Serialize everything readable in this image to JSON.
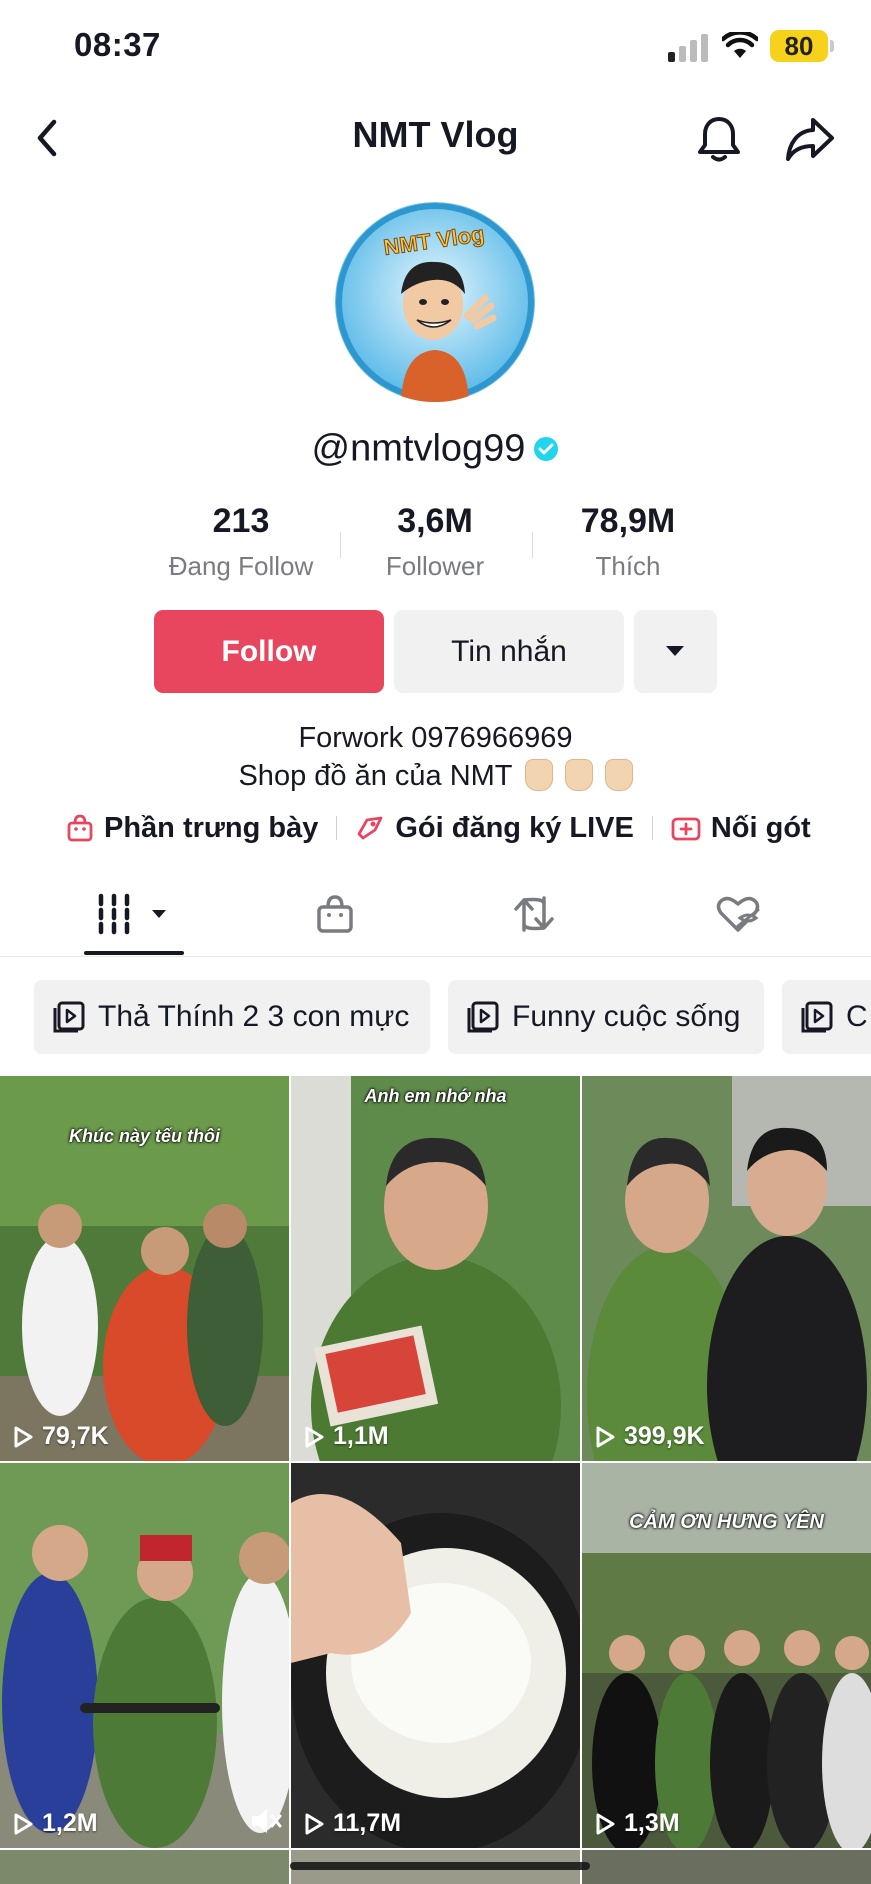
{
  "status_bar": {
    "time": "08:37",
    "battery": "80"
  },
  "header": {
    "title": "NMT Vlog"
  },
  "profile": {
    "avatar_text": "NMT Vlog",
    "handle": "@nmtvlog99",
    "stats": [
      {
        "value": "213",
        "label": "Đang Follow"
      },
      {
        "value": "3,6M",
        "label": "Follower"
      },
      {
        "value": "78,9M",
        "label": "Thích"
      }
    ],
    "follow_label": "Follow",
    "message_label": "Tin nhắn",
    "bio_line1": "Forwork 0976966969",
    "bio_line2": "Shop đồ ăn của NMT",
    "links": [
      {
        "label": "Phần trưng bày",
        "icon": "shop-bag-icon"
      },
      {
        "label": "Gói đăng ký LIVE",
        "icon": "live-subscription-icon"
      },
      {
        "label": "Nối gót",
        "icon": "duet-plus-icon"
      }
    ]
  },
  "tabs": [
    {
      "name": "videos",
      "icon": "grid-icon",
      "active": true
    },
    {
      "name": "shop",
      "icon": "shop-bag-icon",
      "active": false
    },
    {
      "name": "reposts",
      "icon": "repost-icon",
      "active": false
    },
    {
      "name": "liked",
      "icon": "liked-hidden-icon",
      "active": false
    }
  ],
  "playlists": [
    {
      "label": "Thả Thính 2 3 con mực"
    },
    {
      "label": "Funny cuộc sống"
    },
    {
      "label": "C"
    }
  ],
  "videos": [
    {
      "views": "79,7K",
      "caption": "Khúc này tếu thôi"
    },
    {
      "views": "1,1M",
      "caption": "Anh em nhớ nha"
    },
    {
      "views": "399,9K",
      "caption": ""
    },
    {
      "views": "1,2M",
      "caption": ""
    },
    {
      "views": "11,7M",
      "caption": ""
    },
    {
      "views": "1,3M",
      "caption": "CẢM ƠN HƯNG YÊN"
    }
  ],
  "colors": {
    "follow": "#e8465f",
    "verified": "#20d5ec",
    "battery": "#f7d21c"
  }
}
